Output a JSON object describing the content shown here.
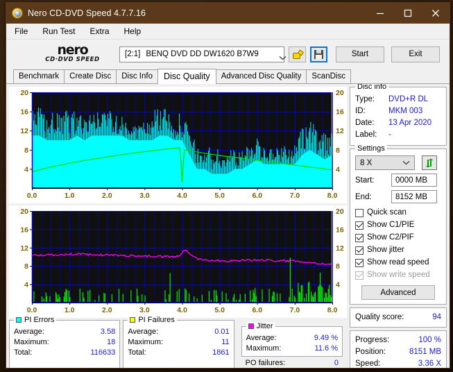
{
  "window": {
    "title": "Nero CD-DVD Speed 4.7.7.16",
    "minimize_label": "minimize-icon",
    "maximize_label": "maximize-icon",
    "close_label": "close-icon"
  },
  "menu": [
    "File",
    "Run Test",
    "Extra",
    "Help"
  ],
  "logo": {
    "line1": "nero",
    "line2": "CD·DVD SPEED"
  },
  "toolbar": {
    "drive_index": "[2:1]",
    "drive_name": "BENQ DVD DD DW1620 B7W9",
    "eject_icon": "plug-icon",
    "save_icon": "floppy-disk-icon",
    "start_label": "Start",
    "exit_label": "Exit"
  },
  "tabs": [
    {
      "label": "Benchmark",
      "active": false
    },
    {
      "label": "Create Disc",
      "active": false
    },
    {
      "label": "Disc Info",
      "active": false
    },
    {
      "label": "Disc Quality",
      "active": true
    },
    {
      "label": "Advanced Disc Quality",
      "active": false
    },
    {
      "label": "ScanDisc",
      "active": false
    }
  ],
  "disc_info": {
    "caption": "Disc info",
    "type_label": "Type:",
    "type_value": "DVD+R DL",
    "id_label": "ID:",
    "id_value": "MKM 003",
    "date_label": "Date:",
    "date_value": "13 Apr 2020",
    "label_label": "Label:",
    "label_value": "-"
  },
  "settings": {
    "caption": "Settings",
    "speed_value": "8 X",
    "refresh_icon": "refresh-icon",
    "start_label": "Start:",
    "start_value": "0000 MB",
    "end_label": "End:",
    "end_value": "8152 MB",
    "checkboxes": [
      {
        "label": "Quick scan",
        "checked": false,
        "disabled": false
      },
      {
        "label": "Show C1/PIE",
        "checked": true,
        "disabled": false
      },
      {
        "label": "Show C2/PIF",
        "checked": true,
        "disabled": false
      },
      {
        "label": "Show jitter",
        "checked": true,
        "disabled": false
      },
      {
        "label": "Show read speed",
        "checked": true,
        "disabled": false
      },
      {
        "label": "Show write speed",
        "checked": true,
        "disabled": true
      }
    ],
    "advanced_label": "Advanced"
  },
  "quality": {
    "label": "Quality score:",
    "value": "94"
  },
  "progress": {
    "progress_label": "Progress:",
    "progress_value": "100 %",
    "position_label": "Position:",
    "position_value": "8151 MB",
    "speed_label": "Speed:",
    "speed_value": "3.36 X"
  },
  "legends": {
    "pi_errors": {
      "caption": "PI Errors",
      "color": "#00ffff",
      "average_label": "Average:",
      "average_value": "3.58",
      "maximum_label": "Maximum:",
      "maximum_value": "18",
      "total_label": "Total:",
      "total_value": "116633"
    },
    "pi_failures": {
      "caption": "PI Failures",
      "color": "#ffff00",
      "average_label": "Average:",
      "average_value": "0.01",
      "maximum_label": "Maximum:",
      "maximum_value": "11",
      "total_label": "Total:",
      "total_value": "1861"
    },
    "jitter": {
      "caption": "Jitter",
      "color": "#ff00ff",
      "average_label": "Average:",
      "average_value": "9.49 %",
      "maximum_label": "Maximum:",
      "maximum_value": "11.6 %",
      "po_label": "PO failures:",
      "po_value": "0"
    }
  },
  "chart_data": [
    {
      "type": "area",
      "id": "pi-errors-chart",
      "title": "PI Errors / Read Speed",
      "xlabel": "",
      "ylabel": "",
      "xlim": [
        0,
        8
      ],
      "ylim": [
        0,
        20
      ],
      "xticks": [
        "0.0",
        "1.0",
        "2.0",
        "3.0",
        "4.0",
        "5.0",
        "6.0",
        "7.0",
        "8.0"
      ],
      "yticks": [
        "4",
        "8",
        "12",
        "16",
        "20"
      ],
      "yticks_right": [
        "4",
        "8",
        "12",
        "16",
        "20"
      ],
      "grid": true,
      "background": "#101010",
      "grid_color": "#0000cc",
      "series": [
        {
          "name": "PI Errors",
          "color": "#00ffff",
          "type": "vertical-bars",
          "note": "dense noisy band, baseline filled solid cyan",
          "envelope_x": [
            0.0,
            0.2,
            0.4,
            0.6,
            0.8,
            1.0,
            1.2,
            1.4,
            1.6,
            1.8,
            2.0,
            2.2,
            2.4,
            2.6,
            2.8,
            3.0,
            3.2,
            3.4,
            3.6,
            3.8,
            4.0,
            4.2,
            4.4,
            4.6,
            4.8,
            5.0,
            5.2,
            5.4,
            5.6,
            5.8,
            6.0,
            6.2,
            6.4,
            6.6,
            6.8,
            7.0,
            7.2,
            7.4,
            7.6,
            7.8,
            8.0
          ],
          "envelope_max": [
            16,
            17,
            15,
            16,
            15,
            17,
            16,
            15,
            16,
            16,
            17,
            17,
            15,
            13,
            13,
            14,
            16,
            18,
            16,
            15,
            16,
            12,
            9,
            8,
            9,
            8,
            7,
            9,
            8,
            9,
            11,
            9,
            8,
            9,
            9,
            9,
            13,
            14,
            13,
            12,
            13
          ],
          "envelope_min": [
            11,
            11,
            10,
            10,
            10,
            10,
            11,
            10,
            11,
            11,
            11,
            11,
            11,
            10,
            10,
            10,
            10,
            11,
            11,
            10,
            10,
            7,
            4,
            4,
            3,
            3,
            3,
            4,
            4,
            5,
            6,
            5,
            5,
            5,
            5,
            5,
            7,
            8,
            7,
            6,
            7
          ]
        },
        {
          "name": "Read speed",
          "color": "#00dd00",
          "type": "line",
          "x": [
            0.0,
            0.5,
            1.0,
            1.5,
            2.0,
            2.5,
            3.0,
            3.5,
            3.95,
            4.0,
            4.05,
            4.5,
            5.0,
            5.5,
            6.0,
            6.5,
            7.0,
            7.5,
            8.0
          ],
          "y": [
            3.4,
            4.4,
            5.2,
            5.9,
            6.5,
            7.1,
            7.6,
            8.1,
            8.4,
            1.2,
            8.0,
            7.4,
            6.8,
            6.3,
            5.8,
            5.3,
            4.8,
            4.3,
            3.8
          ]
        }
      ]
    },
    {
      "type": "line",
      "id": "pi-failures-jitter-chart",
      "title": "PI Failures / Jitter",
      "xlabel": "",
      "ylabel": "",
      "xlim": [
        0,
        8
      ],
      "ylim": [
        0,
        20
      ],
      "xticks": [
        "0.0",
        "1.0",
        "2.0",
        "3.0",
        "4.0",
        "5.0",
        "6.0",
        "7.0",
        "8.0"
      ],
      "yticks": [
        "4",
        "8",
        "12",
        "16",
        "20"
      ],
      "yticks_right": [
        "4",
        "8",
        "12",
        "16",
        "20"
      ],
      "grid": true,
      "background": "#101010",
      "grid_color": "#0000cc",
      "series": [
        {
          "name": "Jitter",
          "color": "#ff00ff",
          "type": "line",
          "x": [
            0.0,
            0.4,
            0.8,
            1.2,
            1.6,
            2.0,
            2.4,
            2.8,
            3.2,
            3.6,
            3.95,
            4.05,
            4.4,
            4.8,
            5.2,
            5.6,
            6.0,
            6.4,
            6.8,
            7.2,
            7.6,
            8.0
          ],
          "y": [
            10.3,
            10.4,
            10.5,
            10.6,
            10.4,
            10.4,
            10.3,
            10.2,
            10.1,
            10.0,
            10.1,
            11.6,
            9.6,
            9.2,
            9.1,
            9.2,
            9.3,
            9.2,
            9.1,
            9.0,
            8.6,
            8.3
          ]
        },
        {
          "name": "PI Failures",
          "color": "#00ff00",
          "type": "spikes",
          "note": "sparse low spikes 1-4 across disc; dense cluster 7.0-8.0 up to 11",
          "density_low_region": [
            0,
            7
          ],
          "density_high_region": [
            7,
            8
          ],
          "max_spike": 11
        }
      ]
    }
  ]
}
